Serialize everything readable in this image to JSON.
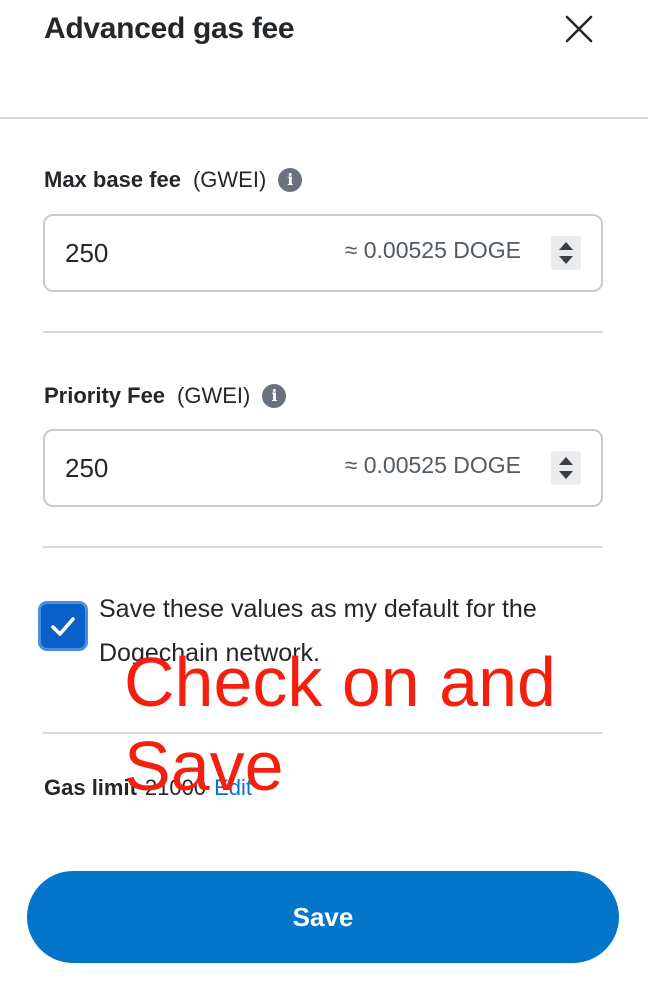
{
  "dialog": {
    "title": "Advanced gas fee",
    "close_icon": "close-icon"
  },
  "max_base_fee": {
    "label": "Max base fee",
    "unit": "(GWEI)",
    "info_icon": "info-icon",
    "value": "250",
    "conversion": "≈ 0.00525 DOGE"
  },
  "priority_fee": {
    "label": "Priority Fee",
    "unit": "(GWEI)",
    "info_icon": "info-icon",
    "value": "250",
    "conversion": "≈ 0.00525 DOGE"
  },
  "default_checkbox": {
    "checked": true,
    "label": "Save these values as my default for the Dogechain network."
  },
  "gas_limit": {
    "label": "Gas limit",
    "value": "21000",
    "edit_label": "Edit"
  },
  "save_button": {
    "label": "Save"
  },
  "annotation": {
    "text": "Check on and Save"
  },
  "colors": {
    "accent": "#0376c9",
    "checkbox": "#0a60c9",
    "annotation": "#f3200f",
    "divider": "#d6d9dc"
  }
}
